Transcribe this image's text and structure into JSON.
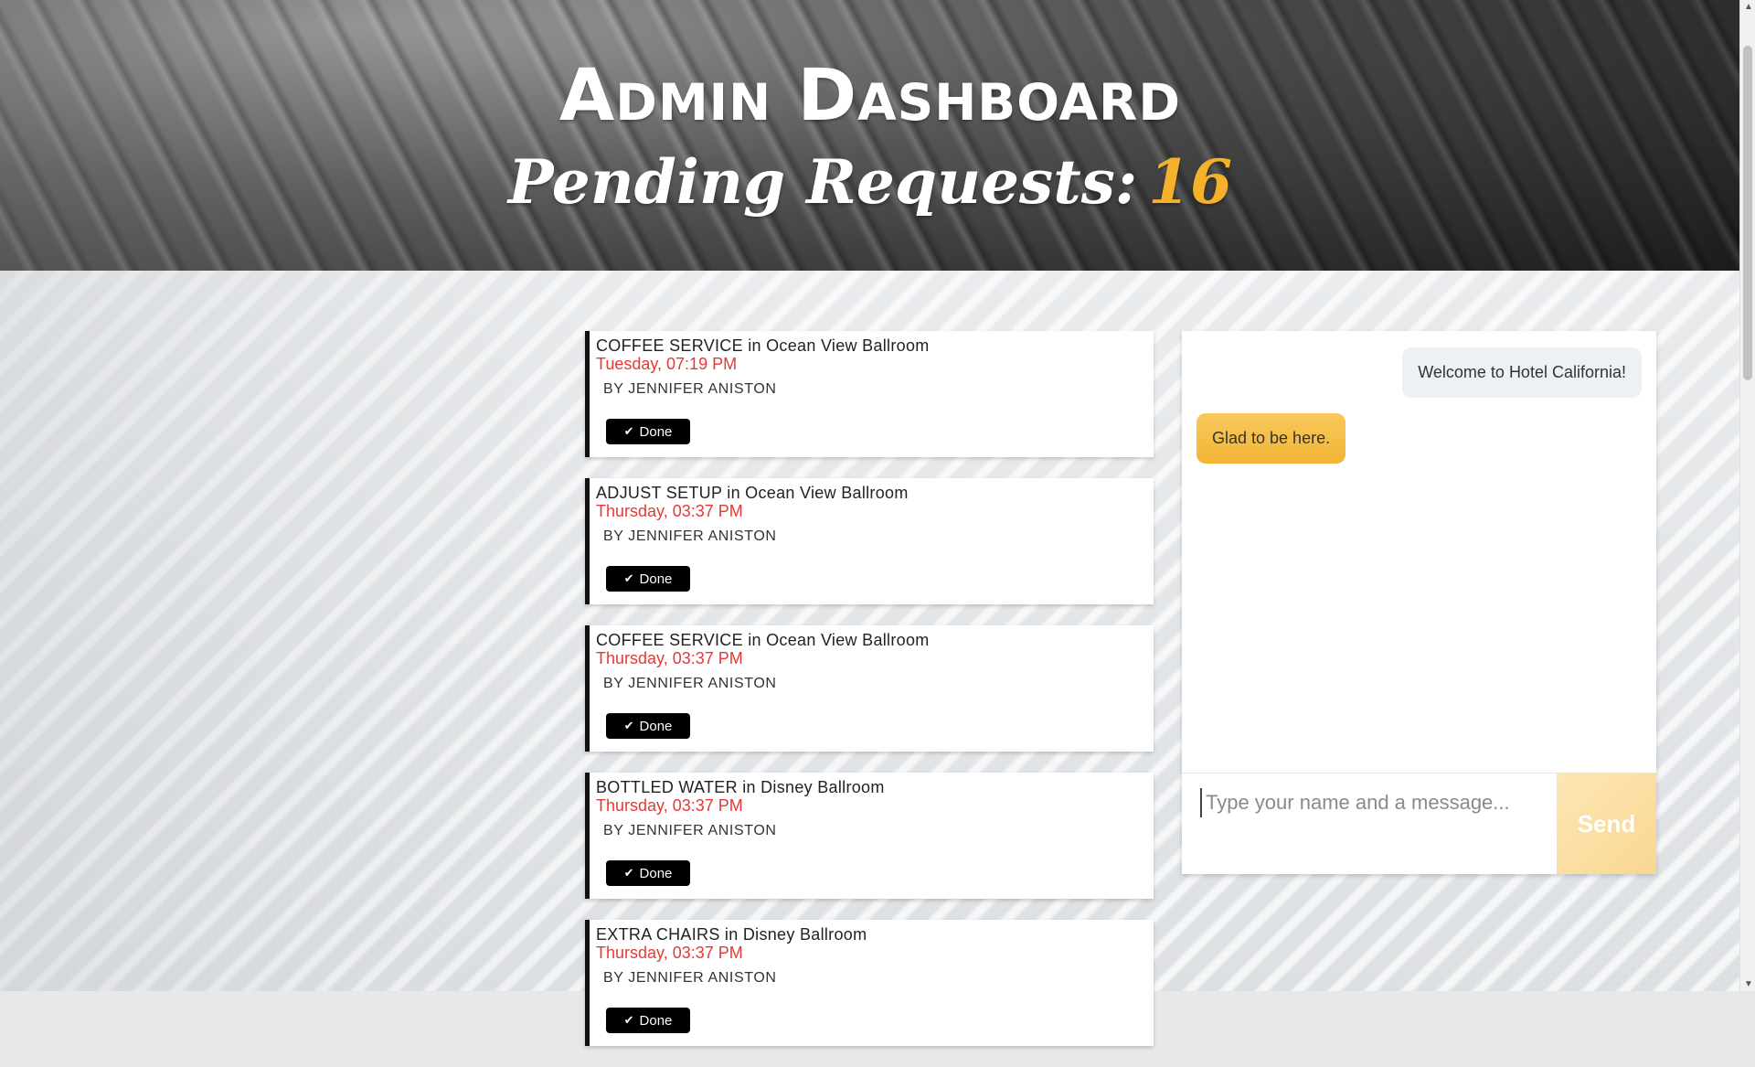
{
  "header": {
    "title": "Admin Dashboard",
    "pending_label": "Pending Requests:",
    "pending_count": "16"
  },
  "requests": [
    {
      "title": "COFFEE SERVICE in Ocean View Ballroom",
      "time": "Tuesday, 07:19 PM",
      "by": "BY JENNIFER ANISTON",
      "button": "Done"
    },
    {
      "title": "ADJUST SETUP in Ocean View Ballroom",
      "time": "Thursday, 03:37 PM",
      "by": "BY JENNIFER ANISTON",
      "button": "Done"
    },
    {
      "title": "COFFEE SERVICE in Ocean View Ballroom",
      "time": "Thursday, 03:37 PM",
      "by": "BY JENNIFER ANISTON",
      "button": "Done"
    },
    {
      "title": "BOTTLED WATER in Disney Ballroom",
      "time": "Thursday, 03:37 PM",
      "by": "BY JENNIFER ANISTON",
      "button": "Done"
    },
    {
      "title": "EXTRA CHAIRS in Disney Ballroom",
      "time": "Thursday, 03:37 PM",
      "by": "BY JENNIFER ANISTON",
      "button": "Done"
    }
  ],
  "chat": {
    "messages": [
      {
        "text": "Welcome to Hotel California!",
        "side": "incoming"
      },
      {
        "text": "Glad to be here.",
        "side": "outgoing"
      }
    ],
    "input_placeholder": "Type your name and a message...",
    "send_label": "Send"
  },
  "colors": {
    "accent": "#f5b12a",
    "time_red": "#e53935",
    "button_black": "#000000"
  },
  "icons": {
    "done": "check-icon"
  }
}
